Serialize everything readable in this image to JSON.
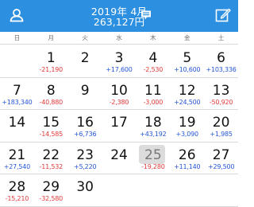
{
  "header": {
    "month": "2019年 4月",
    "total": "263,127円"
  },
  "weekdays": [
    "日",
    "月",
    "火",
    "水",
    "木",
    "金",
    "土"
  ],
  "weeks": [
    [
      {
        "day": "",
        "amount": ""
      },
      {
        "day": "1",
        "amount": "-21,190"
      },
      {
        "day": "2",
        "amount": ""
      },
      {
        "day": "3",
        "amount": "+17,600"
      },
      {
        "day": "4",
        "amount": "-2,530"
      },
      {
        "day": "5",
        "amount": "+10,600"
      },
      {
        "day": "6",
        "amount": "+103,336"
      }
    ],
    [
      {
        "day": "7",
        "amount": "+183,340"
      },
      {
        "day": "8",
        "amount": "-40,880"
      },
      {
        "day": "9",
        "amount": ""
      },
      {
        "day": "10",
        "amount": "-2,380"
      },
      {
        "day": "11",
        "amount": "-3,000"
      },
      {
        "day": "12",
        "amount": "+24,500"
      },
      {
        "day": "13",
        "amount": "-50,920"
      }
    ],
    [
      {
        "day": "14",
        "amount": ""
      },
      {
        "day": "15",
        "amount": "-14,585"
      },
      {
        "day": "16",
        "amount": "+6,736"
      },
      {
        "day": "17",
        "amount": ""
      },
      {
        "day": "18",
        "amount": "+43,192"
      },
      {
        "day": "19",
        "amount": "+3,090"
      },
      {
        "day": "20",
        "amount": "+1,985"
      }
    ],
    [
      {
        "day": "21",
        "amount": "+27,540"
      },
      {
        "day": "22",
        "amount": "-11,532"
      },
      {
        "day": "23",
        "amount": "+5,220"
      },
      {
        "day": "24",
        "amount": ""
      },
      {
        "day": "25",
        "amount": "-19,280",
        "today": true
      },
      {
        "day": "26",
        "amount": "+11,140"
      },
      {
        "day": "27",
        "amount": "+29,500"
      }
    ],
    [
      {
        "day": "28",
        "amount": "-15,210"
      },
      {
        "day": "29",
        "amount": "-32,580"
      },
      {
        "day": "30",
        "amount": ""
      },
      {
        "day": "",
        "amount": ""
      },
      {
        "day": "",
        "amount": ""
      },
      {
        "day": "",
        "amount": ""
      },
      {
        "day": "",
        "amount": ""
      }
    ]
  ],
  "colors": {
    "header_bg": "#2d8fe0",
    "positive": "#2457d6",
    "negative": "#e03a3a",
    "today_highlight": "#dcdcdc"
  },
  "icons": {
    "left": "person-icon",
    "title": "chat-bubble-icon",
    "right": "edit-icon"
  }
}
